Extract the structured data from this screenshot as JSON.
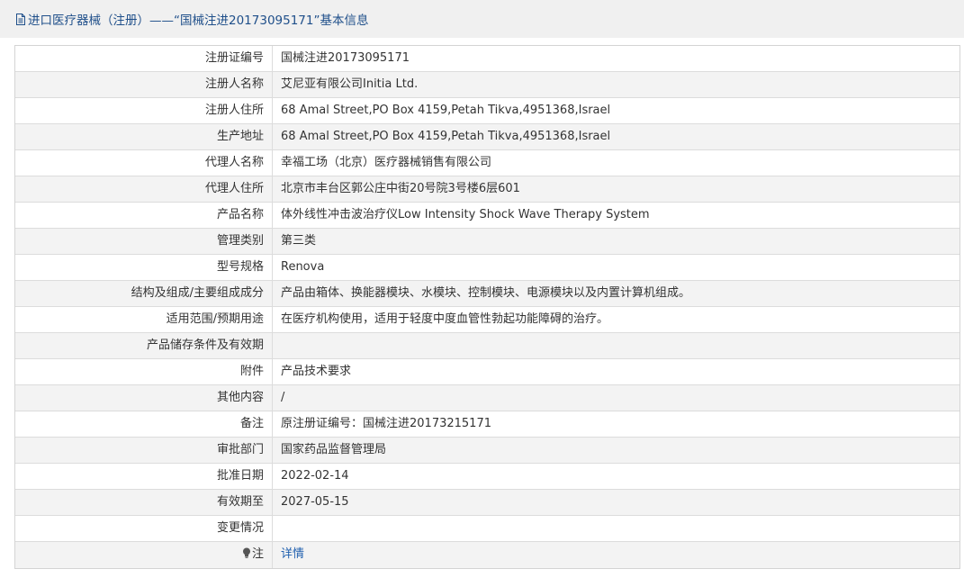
{
  "header": {
    "title": "进口医疗器械（注册）——“国械注进20173095171”基本信息"
  },
  "rows": [
    {
      "label": "注册证编号",
      "value": "国械注进20173095171"
    },
    {
      "label": "注册人名称",
      "value": "艾尼亚有限公司Initia Ltd."
    },
    {
      "label": "注册人住所",
      "value": "68 Amal Street,PO Box 4159,Petah Tikva,4951368,Israel"
    },
    {
      "label": "生产地址",
      "value": "68 Amal Street,PO Box 4159,Petah Tikva,4951368,Israel"
    },
    {
      "label": "代理人名称",
      "value": "幸福工场（北京）医疗器械销售有限公司"
    },
    {
      "label": "代理人住所",
      "value": "北京市丰台区郭公庄中街20号院3号楼6层601"
    },
    {
      "label": "产品名称",
      "value": "体外线性冲击波治疗仪Low Intensity Shock Wave Therapy System"
    },
    {
      "label": "管理类别",
      "value": "第三类"
    },
    {
      "label": "型号规格",
      "value": "Renova"
    },
    {
      "label": "结构及组成/主要组成成分",
      "value": "产品由箱体、换能器模块、水模块、控制模块、电源模块以及内置计算机组成。"
    },
    {
      "label": "适用范围/预期用途",
      "value": "在医疗机构使用，适用于轻度中度血管性勃起功能障碍的治疗。"
    },
    {
      "label": "产品储存条件及有效期",
      "value": ""
    },
    {
      "label": "附件",
      "value": "产品技术要求"
    },
    {
      "label": "其他内容",
      "value": "/"
    },
    {
      "label": "备注",
      "value": "原注册证编号：国械注进20173215171"
    },
    {
      "label": "审批部门",
      "value": "国家药品监督管理局"
    },
    {
      "label": "批准日期",
      "value": "2022-02-14"
    },
    {
      "label": "有效期至",
      "value": "2027-05-15"
    },
    {
      "label": "变更情况",
      "value": ""
    }
  ],
  "note_row": {
    "label": "注",
    "link_text": "详情",
    "icon": "lightbulb-icon"
  },
  "colors": {
    "header_bg": "#f0f0f0",
    "header_text": "#1f4f8a",
    "link": "#1f5fae",
    "row_alt_bg": "#f3f3f3",
    "border": "#dcdcdc"
  }
}
